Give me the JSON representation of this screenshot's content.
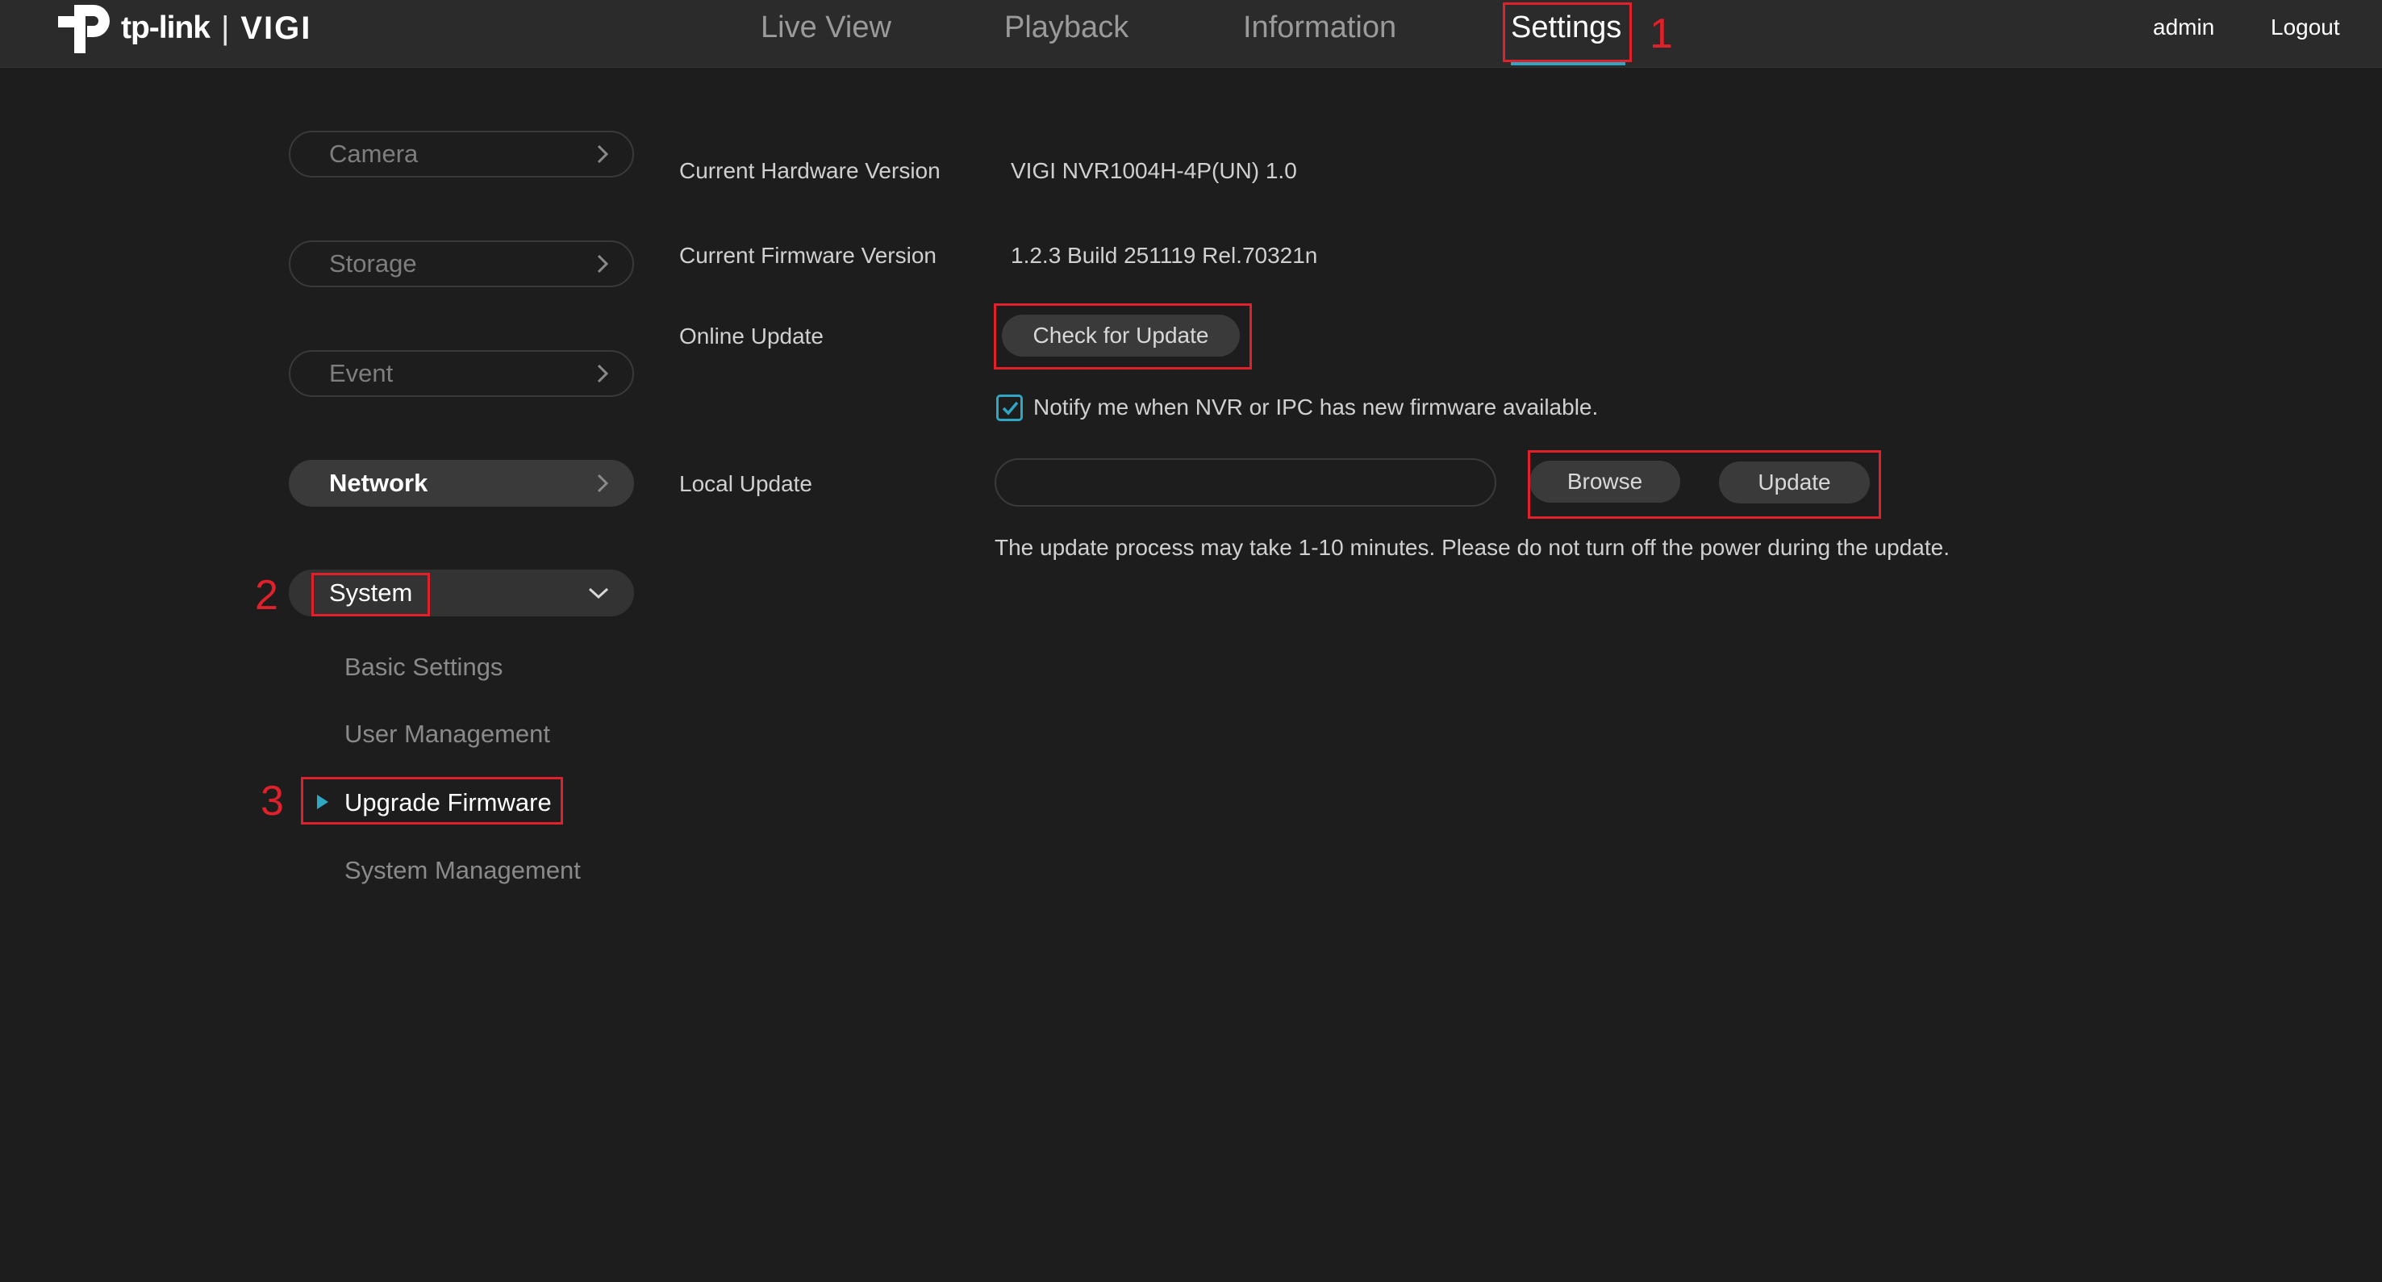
{
  "header": {
    "brand": "tp-link",
    "separator": "|",
    "product": "VIGI",
    "tabs": [
      {
        "label": "Live View"
      },
      {
        "label": "Playback"
      },
      {
        "label": "Information"
      },
      {
        "label": "Settings"
      }
    ],
    "user": "admin",
    "logout": "Logout"
  },
  "sidebar": {
    "items": [
      {
        "label": "Camera"
      },
      {
        "label": "Storage"
      },
      {
        "label": "Event"
      },
      {
        "label": "Network"
      },
      {
        "label": "System"
      }
    ],
    "system_sub": [
      {
        "label": "Basic Settings"
      },
      {
        "label": "User Management"
      },
      {
        "label": "Upgrade Firmware"
      },
      {
        "label": "System Management"
      }
    ]
  },
  "content": {
    "hw_label": "Current Hardware Version",
    "hw_value": "VIGI NVR1004H-4P(UN) 1.0",
    "fw_label": "Current Firmware Version",
    "fw_value": "1.2.3 Build 251119 Rel.70321n",
    "online_label": "Online Update",
    "check_button": "Check for Update",
    "notify_text": "Notify me when NVR or IPC has new firmware available.",
    "notify_checked": true,
    "local_label": "Local Update",
    "file_value": "",
    "browse_button": "Browse",
    "update_button": "Update",
    "note": "The update process may take 1-10 minutes. Please do not turn off the power during the update."
  },
  "annotations": {
    "step1": "1",
    "step2": "2",
    "step3": "3"
  },
  "colors": {
    "accent": "#2fa7c4",
    "annotation": "#e0202a",
    "background": "#1d1d1d",
    "topbar": "#2b2b2b"
  },
  "icons": {
    "logo": "tp-link-logo-icon",
    "chevron_right": "chevron-right-icon",
    "chevron_down": "chevron-down-icon",
    "active_marker": "play-triangle-icon",
    "checkbox": "checkmark-icon"
  }
}
